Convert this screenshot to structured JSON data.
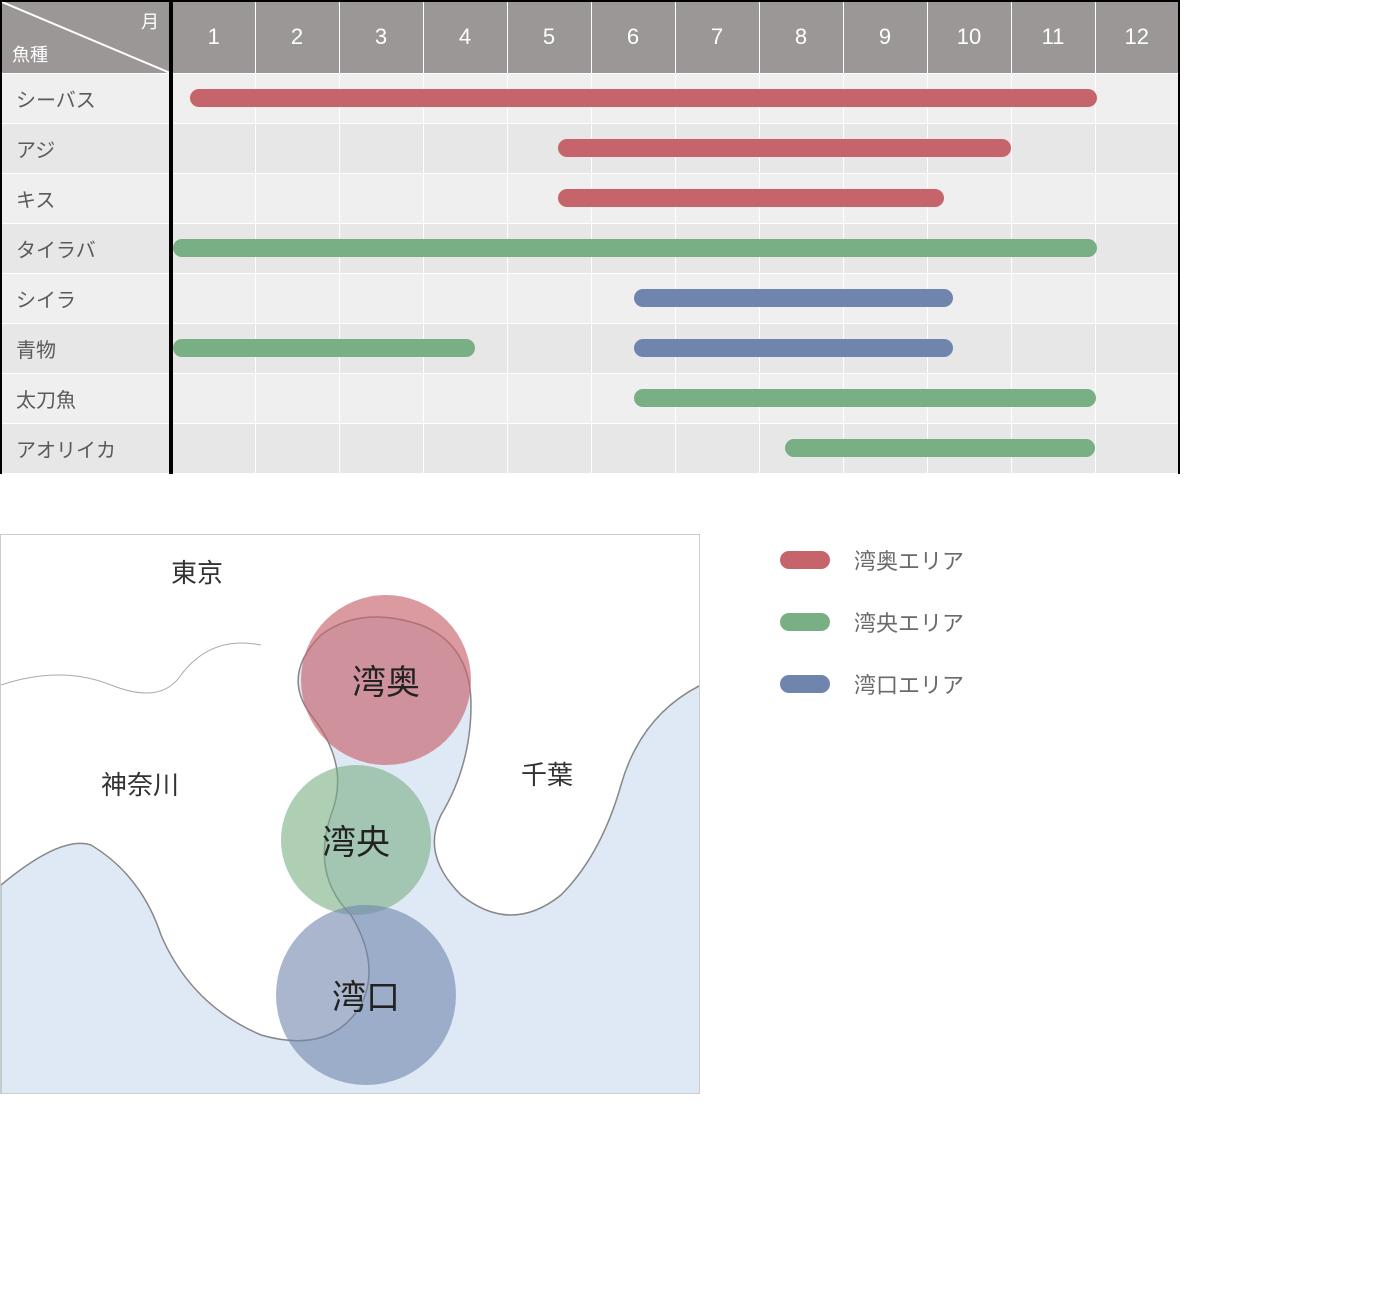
{
  "header": {
    "corner_top": "月",
    "corner_left": "魚種",
    "months": [
      "1",
      "2",
      "3",
      "4",
      "5",
      "6",
      "7",
      "8",
      "9",
      "10",
      "11",
      "12"
    ]
  },
  "colors": {
    "red": "#c6646b",
    "green": "#79af84",
    "blue": "#6f85ae"
  },
  "chart_data": {
    "type": "bar",
    "title": "",
    "xlabel": "月",
    "ylabel": "魚種",
    "x": [
      1,
      2,
      3,
      4,
      5,
      6,
      7,
      8,
      9,
      10,
      11,
      12
    ],
    "categories": [
      "シーバス",
      "アジ",
      "キス",
      "タイラバ",
      "シイラ",
      "青物",
      "太刀魚",
      "アオリイカ"
    ],
    "series_legend": {
      "red": "湾奥エリア",
      "green": "湾央エリア",
      "blue": "湾口エリア"
    },
    "rows": [
      {
        "name": "シーバス",
        "segments": [
          {
            "area": "red",
            "start": 1.2,
            "end": 12.0
          }
        ]
      },
      {
        "name": "アジ",
        "segments": [
          {
            "area": "red",
            "start": 5.6,
            "end": 11.0
          }
        ]
      },
      {
        "name": "キス",
        "segments": [
          {
            "area": "red",
            "start": 5.6,
            "end": 10.2
          }
        ]
      },
      {
        "name": "タイラバ",
        "segments": [
          {
            "area": "green",
            "start": 1.0,
            "end": 12.0
          }
        ]
      },
      {
        "name": "シイラ",
        "segments": [
          {
            "area": "blue",
            "start": 6.5,
            "end": 10.3
          }
        ]
      },
      {
        "name": "青物",
        "segments": [
          {
            "area": "green",
            "start": 1.0,
            "end": 4.6
          },
          {
            "area": "blue",
            "start": 6.5,
            "end": 10.3
          }
        ]
      },
      {
        "name": "太刀魚",
        "segments": [
          {
            "area": "green",
            "start": 6.5,
            "end": 12.0
          }
        ]
      },
      {
        "name": "アオリイカ",
        "segments": [
          {
            "area": "green",
            "start": 8.3,
            "end": 12.0
          }
        ]
      }
    ]
  },
  "map": {
    "places": {
      "tokyo": "東京",
      "kanagawa": "神奈川",
      "chiba": "千葉"
    },
    "areas": {
      "wanoku": "湾奥",
      "wanou": "湾央",
      "wanko": "湾口"
    }
  },
  "legend": [
    {
      "color": "red",
      "label": "湾奥エリア"
    },
    {
      "color": "green",
      "label": "湾央エリア"
    },
    {
      "color": "blue",
      "label": "湾口エリア"
    }
  ]
}
